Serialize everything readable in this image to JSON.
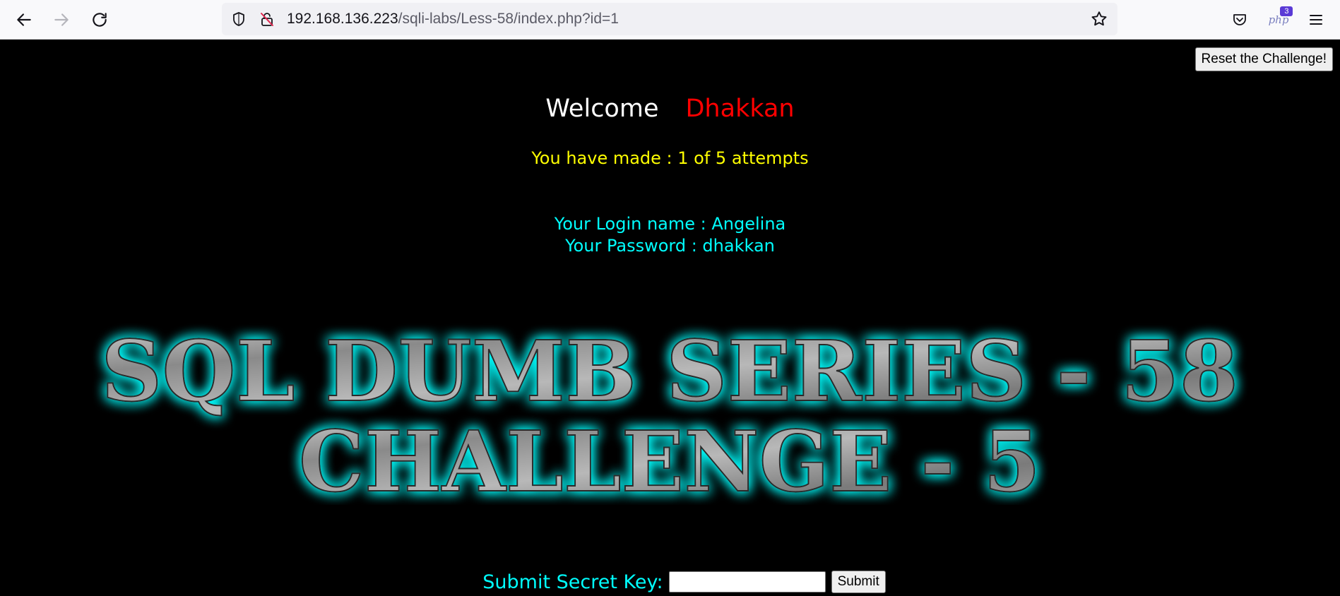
{
  "browser": {
    "url_host": "192.168.136.223",
    "url_path": "/sqli-labs/Less-58/index.php?id=1",
    "php_badge_text": "php",
    "php_badge_count": "3"
  },
  "page": {
    "reset_button": "Reset the Challenge!",
    "welcome_word": "Welcome",
    "welcome_name": "Dhakkan",
    "attempts": "You have made : 1 of 5 attempts",
    "login_name": "Your Login name : Angelina",
    "password": "Your Password : dhakkan",
    "banner_line1": "SQL DUMB SERIES - 58",
    "banner_line2": "CHALLENGE - 5",
    "secret_label": "Submit Secret Key:",
    "secret_value": "",
    "submit_button": "Submit"
  },
  "colors": {
    "background": "#000000",
    "welcome_name": "#ff0000",
    "attempts": "#ffff00",
    "credentials": "#00ffff",
    "banner_glow": "#00ffff"
  }
}
